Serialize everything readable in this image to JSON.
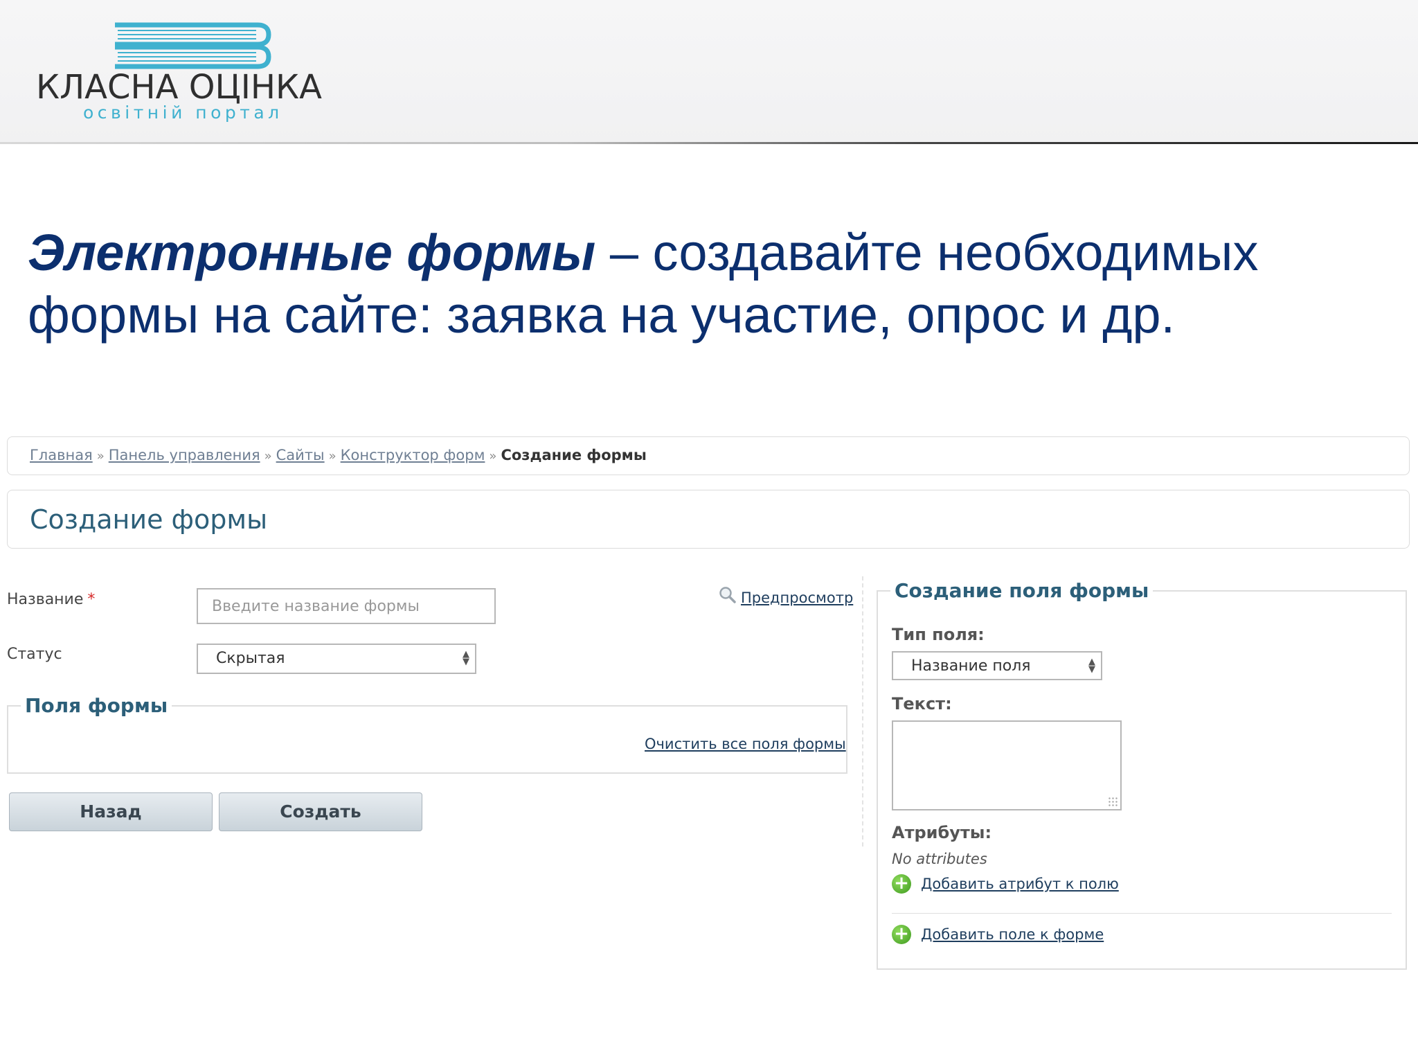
{
  "logo": {
    "title": "КЛАСНА ОЦІНКА",
    "subtitle": "освітній портал",
    "accent_color": "#3fb1cf"
  },
  "headline": {
    "emphasis": "Электронные формы",
    "rest": " – создавайте необходимых формы на сайте: заявка на участие, опрос и др."
  },
  "breadcrumb": {
    "items": [
      "Главная",
      "Панель управления",
      "Сайты",
      "Конструктор форм"
    ],
    "separator": "»",
    "current": "Создание формы"
  },
  "page_title": "Создание формы",
  "form": {
    "name_label": "Название",
    "required_mark": "*",
    "name_placeholder": "Введите название формы",
    "status_label": "Статус",
    "status_value": "Скрытая",
    "preview_link": "Предпросмотр",
    "fields_legend": "Поля формы",
    "clear_link": "Очистить все поля формы",
    "back_button": "Назад",
    "create_button": "Создать"
  },
  "field_panel": {
    "legend": "Создание поля формы",
    "type_label": "Тип поля:",
    "type_value": "Название поля",
    "text_label": "Текст:",
    "attributes_label": "Атрибуты:",
    "no_attributes": "No attributes",
    "add_attribute_link": "Добавить атрибут к полю",
    "add_field_link": "Добавить поле к форме"
  }
}
